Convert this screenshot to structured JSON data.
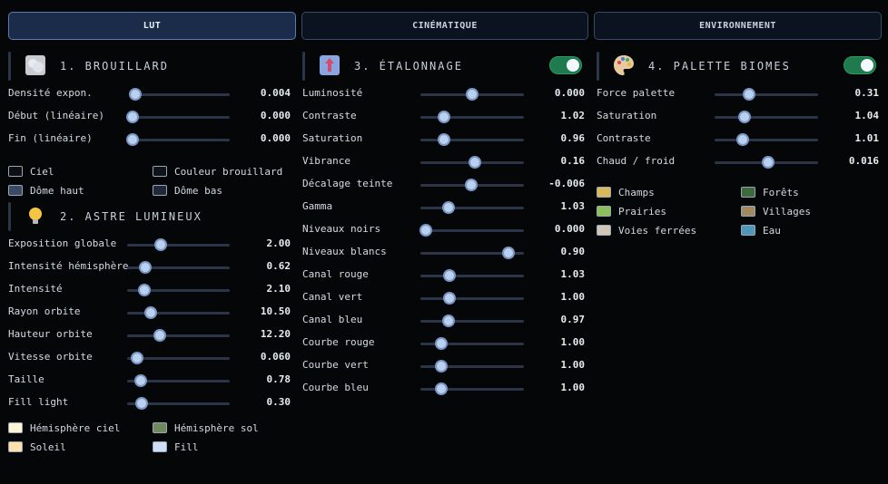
{
  "tabs": [
    "LUT",
    "CINÉMATIQUE",
    "ENVIRONNEMENT"
  ],
  "col1": {
    "section1": {
      "title": "1. BROUILLARD",
      "icon": "fog-icon",
      "rows": [
        {
          "label": "Densité expon.",
          "value": "0.004",
          "fraction": 0.03
        },
        {
          "label": "Début (linéaire)",
          "value": "0.000",
          "fraction": 0.0
        },
        {
          "label": "Fin (linéaire)",
          "value": "0.000",
          "fraction": 0.0
        }
      ],
      "swatches": [
        {
          "label": "Ciel",
          "color": "#0c0f14"
        },
        {
          "label": "Couleur brouillard",
          "color": "#10131a"
        },
        {
          "label": "Dôme haut",
          "color": "#3b4a64"
        },
        {
          "label": "Dôme bas",
          "color": "#20283a"
        }
      ]
    },
    "section2": {
      "title": "2. ASTRE LUMINEUX",
      "icon": "lightbulb-icon",
      "rows": [
        {
          "label": "Exposition globale",
          "value": "2.00",
          "fraction": 0.33
        },
        {
          "label": "Intensité hémisphère",
          "value": "0.62",
          "fraction": 0.18
        },
        {
          "label": "Intensité",
          "value": "2.10",
          "fraction": 0.17
        },
        {
          "label": "Rayon orbite",
          "value": "10.50",
          "fraction": 0.23
        },
        {
          "label": "Hauteur orbite",
          "value": "12.20",
          "fraction": 0.32
        },
        {
          "label": "Vitesse orbite",
          "value": "0.060",
          "fraction": 0.1
        },
        {
          "label": "Taille",
          "value": "0.78",
          "fraction": 0.13
        },
        {
          "label": "Fill light",
          "value": "0.30",
          "fraction": 0.14
        }
      ],
      "swatches": [
        {
          "label": "Hémisphère ciel",
          "color": "#fff3d6"
        },
        {
          "label": "Hémisphère sol",
          "color": "#6f8a5a"
        },
        {
          "label": "Soleil",
          "color": "#fde0b0"
        },
        {
          "label": "Fill",
          "color": "#cfdff5"
        }
      ]
    }
  },
  "col2": {
    "section": {
      "title": "3. ÉTALONNAGE",
      "icon": "color-grading-icon",
      "rows": [
        {
          "label": "Luminosité",
          "value": "0.000",
          "fraction": 0.5
        },
        {
          "label": "Contraste",
          "value": "1.02",
          "fraction": 0.23
        },
        {
          "label": "Saturation",
          "value": "0.96",
          "fraction": 0.23
        },
        {
          "label": "Vibrance",
          "value": "0.16",
          "fraction": 0.53
        },
        {
          "label": "Décalage teinte",
          "value": "-0.006",
          "fraction": 0.49
        },
        {
          "label": "Gamma",
          "value": "1.03",
          "fraction": 0.27
        },
        {
          "label": "Niveaux noirs",
          "value": "0.000",
          "fraction": 0.05
        },
        {
          "label": "Niveaux blancs",
          "value": "0.90",
          "fraction": 0.85
        },
        {
          "label": "Canal rouge",
          "value": "1.03",
          "fraction": 0.28
        },
        {
          "label": "Canal vert",
          "value": "1.00",
          "fraction": 0.28
        },
        {
          "label": "Canal bleu",
          "value": "0.97",
          "fraction": 0.27
        },
        {
          "label": "Courbe rouge",
          "value": "1.00",
          "fraction": 0.2
        },
        {
          "label": "Courbe vert",
          "value": "1.00",
          "fraction": 0.2
        },
        {
          "label": "Courbe bleu",
          "value": "1.00",
          "fraction": 0.2
        }
      ]
    }
  },
  "col3": {
    "section": {
      "title": "4. PALETTE BIOMES",
      "icon": "palette-icon",
      "rows": [
        {
          "label": "Force palette",
          "value": "0.31",
          "fraction": 0.33
        },
        {
          "label": "Saturation",
          "value": "1.04",
          "fraction": 0.29
        },
        {
          "label": "Contraste",
          "value": "1.01",
          "fraction": 0.27
        },
        {
          "label": "Chaud / froid",
          "value": "0.016",
          "fraction": 0.52
        }
      ],
      "swatches": [
        {
          "label": "Champs",
          "color": "#d9b85a"
        },
        {
          "label": "Forêts",
          "color": "#3f6b3a"
        },
        {
          "label": "Prairies",
          "color": "#8bbf5e"
        },
        {
          "label": "Villages",
          "color": "#a08a63"
        },
        {
          "label": "Voies ferrées",
          "color": "#cfc6b8"
        },
        {
          "label": "Eau",
          "color": "#4f96b8"
        }
      ]
    }
  },
  "colors": {
    "accent": "#5a7bb0",
    "toggle_on": "#1f7a4d",
    "thumb": "#b9d0ef"
  }
}
